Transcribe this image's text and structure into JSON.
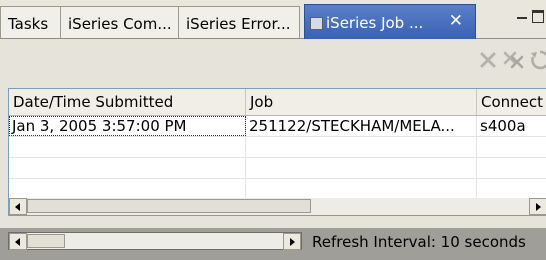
{
  "tabs": [
    {
      "label": "Tasks"
    },
    {
      "label": "iSeries Com..."
    },
    {
      "label": "iSeries Error..."
    },
    {
      "label": "iSeries Job ..."
    }
  ],
  "table": {
    "columns": [
      "Date/Time Submitted",
      "Job",
      "Connect"
    ],
    "rows": [
      [
        "Jan 3, 2005 3:57:00 PM",
        "251122/STECKHAM/MELA...",
        "s400a"
      ]
    ]
  },
  "status": {
    "refresh_text": "Refresh Interval: 10 seconds"
  }
}
